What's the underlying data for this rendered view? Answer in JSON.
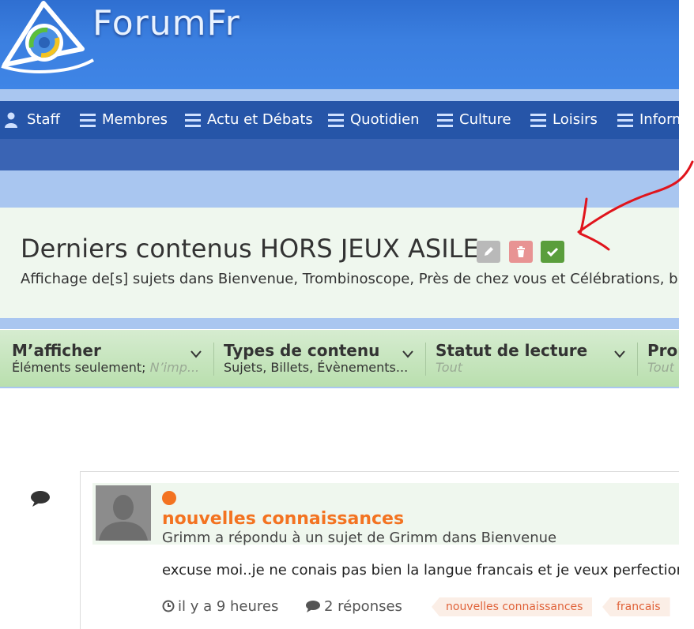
{
  "site": {
    "logo_text": "ForumFr"
  },
  "nav": {
    "items": [
      {
        "label": "Staff",
        "icon": "user-icon"
      },
      {
        "label": "Membres",
        "icon": "menu-icon"
      },
      {
        "label": "Actu et Débats",
        "icon": "menu-icon"
      },
      {
        "label": "Quotidien",
        "icon": "menu-icon"
      },
      {
        "label": "Culture",
        "icon": "menu-icon"
      },
      {
        "label": "Loisirs",
        "icon": "menu-icon"
      },
      {
        "label": "Inform",
        "icon": "menu-icon"
      }
    ]
  },
  "stream": {
    "title": "Derniers contenus HORS JEUX ASILE",
    "description": "Affichage de[s] sujets dans Bienvenue, Trombinoscope, Près de chez vous et Célébrations, b",
    "actions": {
      "edit_icon": "pencil-icon",
      "delete_icon": "trash-icon",
      "confirm_icon": "check-icon"
    }
  },
  "filters": [
    {
      "label": "M’afficher",
      "value": "Éléments seulement;",
      "value_muted": "N’imp..."
    },
    {
      "label": "Types de contenu",
      "value": "Sujets, Billets, Évènements...",
      "value_muted": ""
    },
    {
      "label": "Statut de lecture",
      "value": "",
      "value_muted": "Tout"
    },
    {
      "label": "Prop",
      "value": "",
      "value_muted": "Tout"
    }
  ],
  "activity": {
    "topic_title": "nouvelles connaissances",
    "meta": "Grimm a répondu à un sujet de Grimm dans Bienvenue",
    "excerpt": "excuse moi..je ne conais pas bien la langue francais et je veux perfection",
    "time": "il y a 9 heures",
    "replies": "2 réponses",
    "tags": [
      "nouvelles connaissances",
      "francais"
    ]
  },
  "colors": {
    "accent_orange": "#f37321",
    "nav_bg": "#2655a8",
    "filter_bg": "#b9dfae",
    "panel_bg": "#eff7ee",
    "confirm_green": "#5a9e3c",
    "delete_red": "#e89393",
    "annotation_red": "#e0141c"
  }
}
